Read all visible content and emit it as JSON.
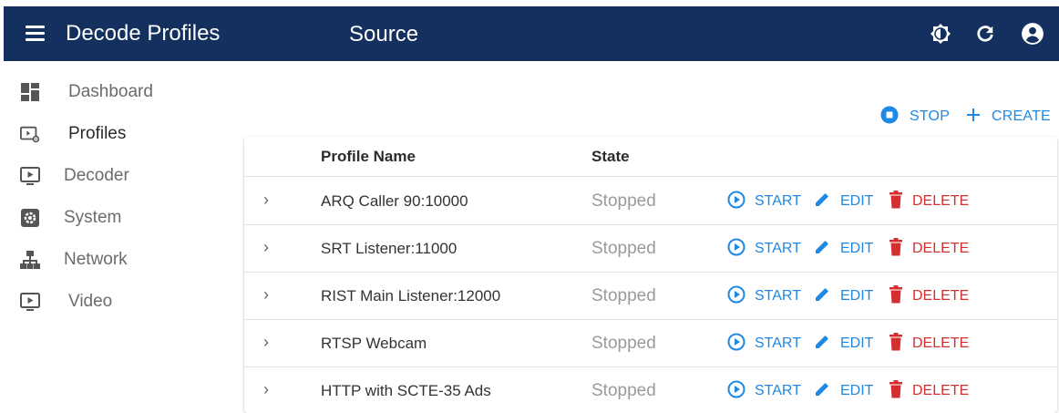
{
  "appbar": {
    "title": "Decode Profiles",
    "section": "Source",
    "icons": [
      "menu-icon",
      "brightness-icon",
      "refresh-icon",
      "account-icon"
    ]
  },
  "sidebar": {
    "items": [
      {
        "label": "Dashboard",
        "icon": "dashboard-icon",
        "active": false
      },
      {
        "label": "Profiles",
        "icon": "profiles-icon",
        "active": true
      },
      {
        "label": "Decoder",
        "icon": "decoder-icon",
        "active": false
      },
      {
        "label": "System",
        "icon": "system-icon",
        "active": false
      },
      {
        "label": "Network",
        "icon": "network-icon",
        "active": false
      },
      {
        "label": "Video",
        "icon": "video-icon",
        "active": false
      }
    ]
  },
  "toolbar": {
    "stop_label": "STOP",
    "create_label": "CREATE"
  },
  "table": {
    "columns": [
      "Profile Name",
      "State"
    ],
    "rows": [
      {
        "name": "ARQ Caller 90:10000",
        "state": "Stopped"
      },
      {
        "name": "SRT Listener:11000",
        "state": "Stopped"
      },
      {
        "name": "RIST Main Listener:12000",
        "state": "Stopped"
      },
      {
        "name": "RTSP Webcam",
        "state": "Stopped"
      },
      {
        "name": "HTTP with SCTE-35 Ads",
        "state": "Stopped"
      }
    ],
    "actions": {
      "start": "START",
      "edit": "EDIT",
      "delete": "DELETE"
    }
  },
  "colors": {
    "appbar": "#13305e",
    "accent": "#1e88e5",
    "danger": "#d32f2f",
    "muted": "#9a9a9a"
  }
}
